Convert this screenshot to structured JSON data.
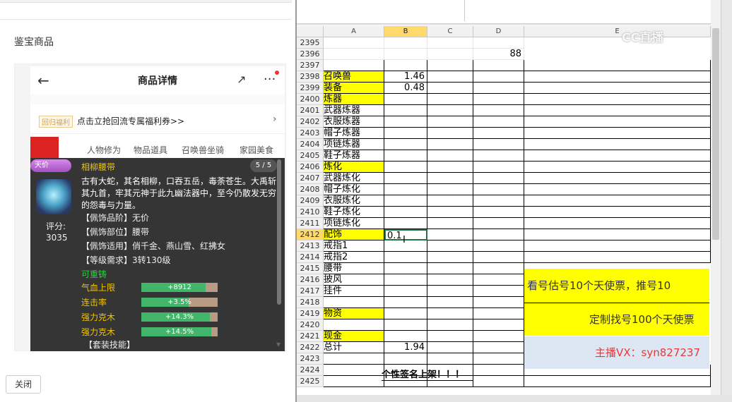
{
  "left_panel": {
    "title": "鉴宝商品",
    "close_label": "关闭"
  },
  "phone": {
    "header_title": "商品详情",
    "back_icon": "arrow-left-icon",
    "share_icon": "share-icon",
    "more_icon": "more-icon",
    "promo_tag": "回归福利",
    "promo_text": "点击立抢回流专属福利券>>",
    "tabs": [
      "人物修为",
      "物品道具",
      "召唤兽坐骑",
      "家园美食"
    ],
    "card": {
      "badge": "天价",
      "name": "相柳腰带",
      "page": "5 / 5",
      "score_label": "评分:",
      "score_value": "3035",
      "description": "古有大蛇，其名相柳，口吞五岳，毒荼苍生。大禹斩其九首，牢其元神于此九幽法器中，至今仍散发无穷的怨毒与力量。",
      "attributes": [
        "【佩饰品阶】无价",
        "【佩饰部位】腰带",
        "【佩饰适用】俏千金、燕山雪、红拂女",
        "【等级需求】3转130级"
      ],
      "recast": "可重铸",
      "stats": [
        {
          "label": "气血上限",
          "value": "+8912",
          "fill": 0.84
        },
        {
          "label": "连击率",
          "value": "+3.5%",
          "fill": 0.62
        },
        {
          "label": "强力克木",
          "value": "+14.3%",
          "fill": 0.9
        },
        {
          "label": "强力克木",
          "value": "+14.5%",
          "fill": 0.92
        }
      ],
      "set_skill": "【套装技能】"
    }
  },
  "sheet": {
    "columns": [
      "A",
      "B",
      "C",
      "D",
      "E"
    ],
    "rows": [
      {
        "n": "2395",
        "a": "",
        "b": "",
        "d": ""
      },
      {
        "n": "2396",
        "a": "",
        "b": "",
        "d": "88"
      },
      {
        "n": "2397",
        "a": "",
        "b": "",
        "d": ""
      },
      {
        "n": "2398",
        "a": "召唤兽",
        "b": "1.46",
        "ya": true
      },
      {
        "n": "2399",
        "a": "装备",
        "b": "0.48",
        "ya": true
      },
      {
        "n": "2400",
        "a": "炼器",
        "b": "",
        "ya": true
      },
      {
        "n": "2401",
        "a": "武器炼器",
        "b": ""
      },
      {
        "n": "2402",
        "a": "衣服炼器",
        "b": ""
      },
      {
        "n": "2403",
        "a": "帽子炼器",
        "b": ""
      },
      {
        "n": "2404",
        "a": "项链炼器",
        "b": ""
      },
      {
        "n": "2405",
        "a": "鞋子炼器",
        "b": ""
      },
      {
        "n": "2406",
        "a": "炼化",
        "b": "",
        "ya": true
      },
      {
        "n": "2407",
        "a": "武器炼化",
        "b": ""
      },
      {
        "n": "2408",
        "a": "帽子炼化",
        "b": ""
      },
      {
        "n": "2409",
        "a": "衣服炼化",
        "b": ""
      },
      {
        "n": "2410",
        "a": "鞋子炼化",
        "b": ""
      },
      {
        "n": "2411",
        "a": "项链炼化",
        "b": ""
      },
      {
        "n": "2412",
        "a": "配饰",
        "b": "0.1",
        "ya": true
      },
      {
        "n": "2413",
        "a": "戒指1",
        "b": ""
      },
      {
        "n": "2414",
        "a": "戒指2",
        "b": ""
      },
      {
        "n": "2415",
        "a": "腰带",
        "b": ""
      },
      {
        "n": "2416",
        "a": "披风",
        "b": ""
      },
      {
        "n": "2417",
        "a": "挂件",
        "b": ""
      },
      {
        "n": "2418",
        "a": "",
        "b": ""
      },
      {
        "n": "2419",
        "a": "物资",
        "b": "",
        "ya": true
      },
      {
        "n": "2420",
        "a": "",
        "b": ""
      },
      {
        "n": "2421",
        "a": "现金",
        "b": "",
        "ya": true
      },
      {
        "n": "2422",
        "a": "总计",
        "b": "1.94"
      },
      {
        "n": "2423",
        "a": "",
        "b": ""
      },
      {
        "n": "2424",
        "a": "",
        "b": ""
      },
      {
        "n": "2425",
        "a": "",
        "b": ""
      }
    ],
    "note1": "看号估号10个天使票，推号10",
    "note2": "定制找号100个天使票",
    "note3": "主播VX：syn827237",
    "banner": "个性签名上架！！！",
    "watermark": "CC直播"
  }
}
